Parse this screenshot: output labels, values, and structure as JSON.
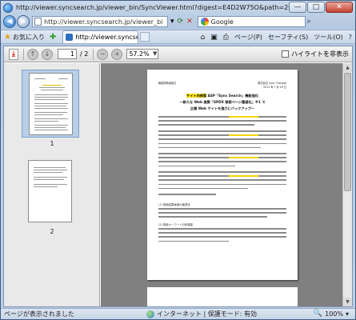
{
  "window": {
    "title": "http://viewer.syncsearch.jp/viewer_bin/SyncViewer.html?digest=E4D2W75O&path=20110729104707869a-",
    "minimize": "—",
    "maximize": "□",
    "close": "✕"
  },
  "address": {
    "url": "http://viewer.syncsearch.jp/viewer_bi",
    "search_engine": "Google"
  },
  "command_bar": {
    "favorites_label": "お気に入り",
    "tab_title": "http://viewer.syncse...",
    "page_menu": "ページ(P)",
    "safety_menu": "セーフティ(S)",
    "tools_menu": "ツール(O)",
    "help_menu": "?"
  },
  "pdf_toolbar": {
    "current_page": "1",
    "total_pages": "/ 2",
    "zoom": "57.2%",
    "highlight_label": "ハイライトを非表示"
  },
  "thumbnails": [
    {
      "label": "1",
      "selected": true
    },
    {
      "label": "2",
      "selected": false
    }
  ],
  "document": {
    "header_left": "報道関係者各位",
    "header_right": "株式会社 Sync Thought",
    "header_date": "2011 年 7 月 29 日",
    "title_line1_hl": "サイト内検索",
    "title_line1_rest": " ASP「Sync Search」機能強化",
    "title_line2": "～新たな Web 施策「SPDX 検索ページ最適化」※1 で",
    "title_line3": "企業 Web サイトを強力にバックアップ～",
    "section1": "(1) 検索結果画面の最適化",
    "section2": "(2) 検索キーワード分析機能"
  },
  "status": {
    "left": "ページが表示されました",
    "zone": "インターネット | 保護モード: 有効",
    "zoom": "100%"
  },
  "colors": {
    "highlight": "#ffea00",
    "frame": "#b5c9e1",
    "doc_background": "#808080"
  }
}
